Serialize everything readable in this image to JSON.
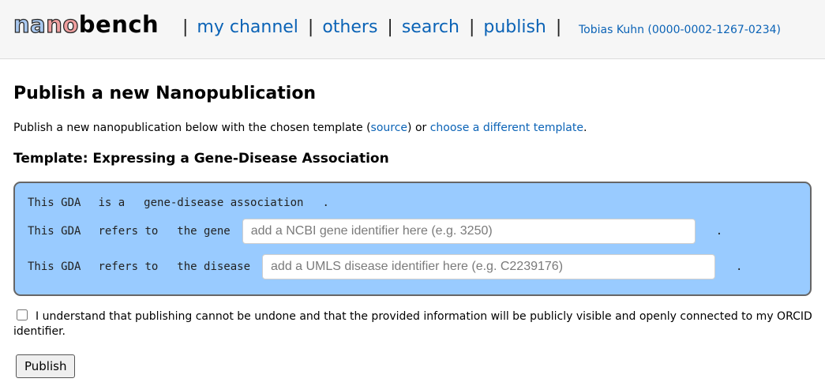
{
  "header": {
    "logo_part1": "na",
    "logo_part2": "no",
    "logo_part3": "bench",
    "nav": {
      "sep": "|",
      "my_channel": "my channel",
      "others": "others",
      "search": "search",
      "publish": "publish"
    },
    "user": "Tobias Kuhn (0000-0002-1267-0234)"
  },
  "main": {
    "title": "Publish a new Nanopublication",
    "intro_pre": "Publish a new nanopublication below with the chosen template (",
    "intro_source": "source",
    "intro_mid": ") or ",
    "intro_choose": "choose a different template",
    "intro_end": ".",
    "template_title": "Template: Expressing a Gene-Disease Association",
    "statements": [
      {
        "subject": "This GDA",
        "predicate": "is a",
        "object": "gene-disease association",
        "end": "."
      },
      {
        "subject": "This GDA",
        "predicate": "refers to",
        "object": "the gene",
        "placeholder": "add a NCBI gene identifier here (e.g. 3250)",
        "value": "",
        "end": "."
      },
      {
        "subject": "This GDA",
        "predicate": "refers to",
        "object": "the disease",
        "placeholder": "add a UMLS disease identifier here (e.g. C2239176)",
        "value": "",
        "end": "."
      }
    ],
    "consent_text": "I understand that publishing cannot be undone and that the provided information will be publicly visible and openly connected to my ORCID identifier.",
    "consent_checked": false,
    "publish_label": "Publish"
  },
  "colors": {
    "link": "#0b63b6",
    "template_bg": "#99cbff",
    "template_border": "#666666",
    "header_bg": "#f6f6f6"
  }
}
